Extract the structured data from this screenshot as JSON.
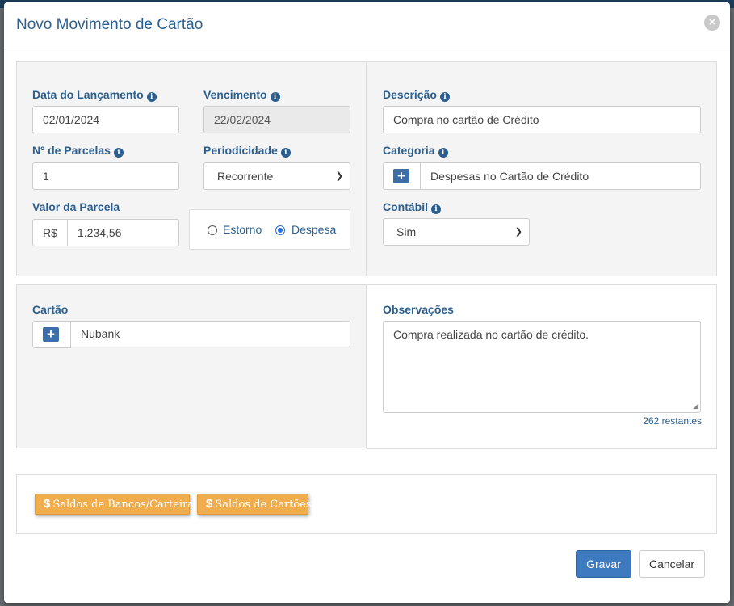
{
  "modal": {
    "title": "Novo Movimento de Cartão",
    "close_icon": "close-icon"
  },
  "left_panel": {
    "data_lancamento": {
      "label": "Data do Lançamento",
      "value": "02/01/2024"
    },
    "vencimento": {
      "label": "Vencimento",
      "value": "22/02/2024"
    },
    "parcelas": {
      "label": "Nº de Parcelas",
      "value": "1"
    },
    "periodicidade": {
      "label": "Periodicidade",
      "selected": "Recorrente"
    },
    "valor_parcela": {
      "label": "Valor da Parcela",
      "prefix": "R$",
      "value": "1.234,56"
    },
    "tipo": {
      "options": [
        "Estorno",
        "Despesa"
      ],
      "selected": "Despesa"
    }
  },
  "right_panel": {
    "descricao": {
      "label": "Descrição",
      "value": "Compra no cartão de Crédito"
    },
    "categoria": {
      "label": "Categoria",
      "value": "Despesas no Cartão de Crédito"
    },
    "contabil": {
      "label": "Contábil",
      "selected": "Sim"
    }
  },
  "cartao_panel": {
    "cartao": {
      "label": "Cartão",
      "value": "Nubank"
    }
  },
  "obs_panel": {
    "observacoes": {
      "label": "Observações",
      "value": "Compra realizada no cartão de crédito.",
      "remaining": "262 restantes"
    }
  },
  "saldos": {
    "bancos_label": "Saldos de Bancos/Carteiras",
    "cartoes_label": "Saldos de Cartões",
    "dollar": "$"
  },
  "footer": {
    "save_label": "Gravar",
    "cancel_label": "Cancelar"
  },
  "colors": {
    "accent": "#2c5f8f",
    "primary_button": "#3d7ac0",
    "orange_button": "#f0ad4e"
  }
}
